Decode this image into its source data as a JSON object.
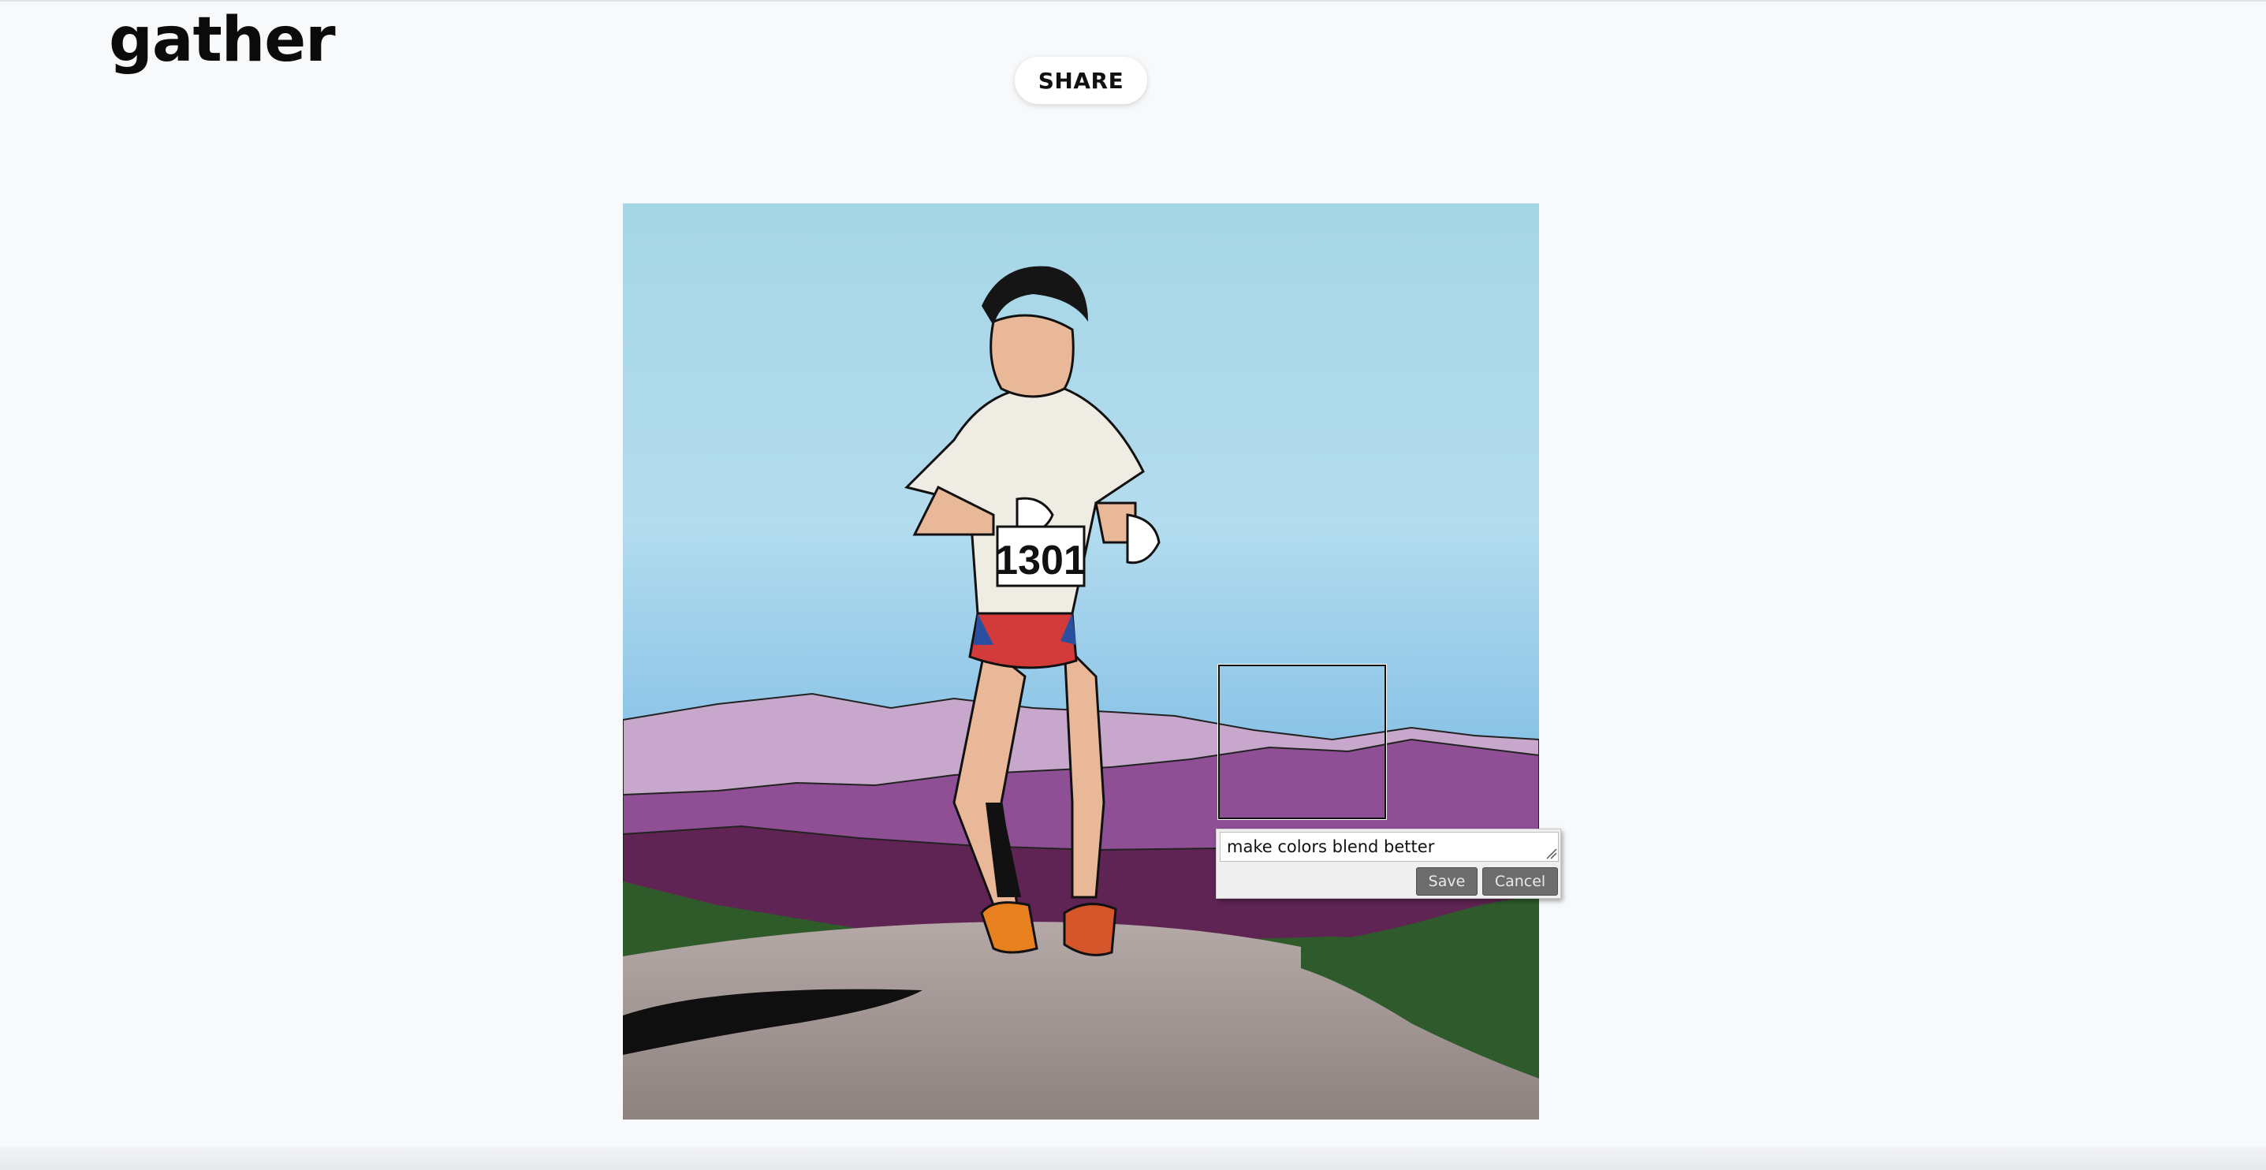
{
  "app": {
    "logo_text": "gather"
  },
  "toolbar": {
    "share_label": "SHARE"
  },
  "editor": {
    "comment_value": "make colors blend better",
    "save_label": "Save",
    "cancel_label": "Cancel"
  },
  "image": {
    "bib_number": "1301"
  }
}
